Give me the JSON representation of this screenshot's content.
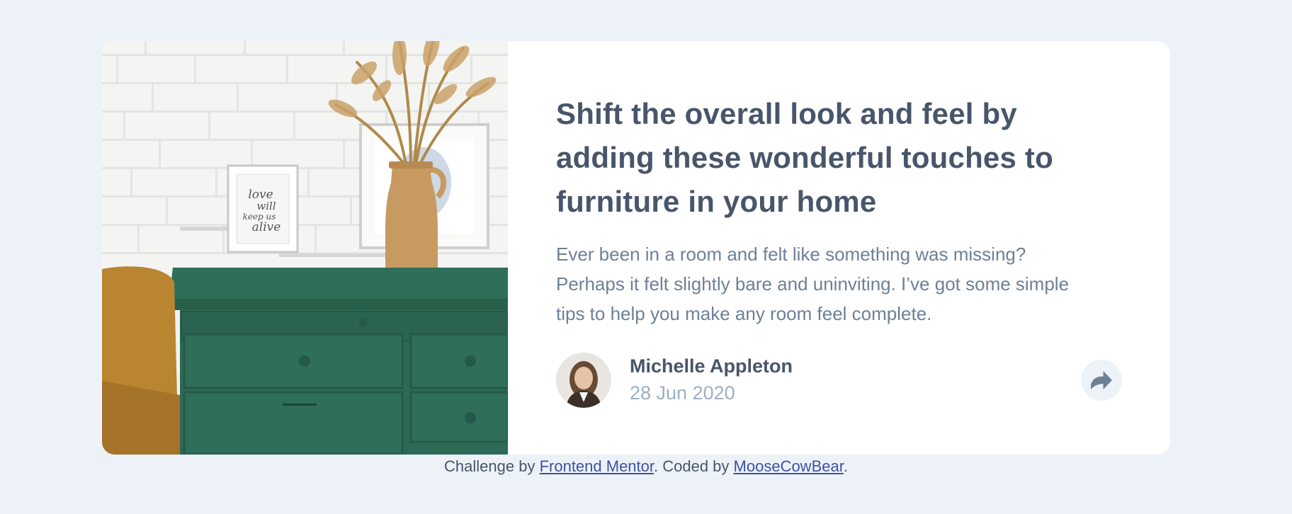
{
  "article": {
    "title": "Shift the overall look and feel by adding these wonderful touches to furniture in your home",
    "description": "Ever been in a room and felt like something was missing? Perhaps it felt slightly bare and uninviting. I’ve got some simple tips to help you make any room feel complete.",
    "image_frame_text": [
      "love",
      "will",
      "keep us",
      "alive"
    ]
  },
  "author": {
    "name": "Michelle Appleton",
    "date": "28 Jun 2020"
  },
  "share": {
    "icon": "share-icon"
  },
  "footer": {
    "prefix": "Challenge by ",
    "link1": "Frontend Mentor",
    "middle": ". Coded by ",
    "link2": "MooseCowBear",
    "suffix": "."
  },
  "colors": {
    "background": "#ecf2f8",
    "heading": "#48556a",
    "body": "#6e8098",
    "muted": "#9eafc2",
    "link": "#3e52a3",
    "dresser": "#2f6e58"
  }
}
